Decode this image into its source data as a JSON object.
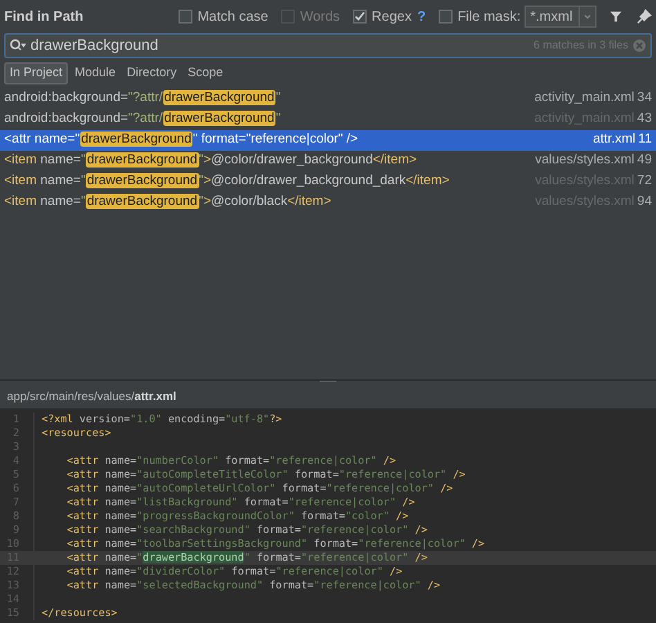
{
  "window": {
    "title": "Find in Path"
  },
  "options": [
    {
      "kind": "checkbox",
      "label": "Match case",
      "checked": false,
      "disabled": false
    },
    {
      "kind": "checkbox",
      "label": "Words",
      "checked": false,
      "disabled": true
    },
    {
      "kind": "checkbox",
      "label": "Regex",
      "checked": true,
      "disabled": false,
      "help": "?"
    },
    {
      "kind": "checkbox",
      "label": "File mask:",
      "checked": false,
      "disabled": false
    }
  ],
  "file_mask": {
    "value": "*.mxml"
  },
  "search": {
    "value": "drawerBackground",
    "summary": "6 matches in 3 files"
  },
  "scopes": [
    {
      "label": "In Project",
      "selected": true
    },
    {
      "label": "Module",
      "selected": false
    },
    {
      "label": "Directory",
      "selected": false
    },
    {
      "label": "Scope",
      "selected": false
    }
  ],
  "results": [
    {
      "selected": false,
      "segments": [
        {
          "kind": "text",
          "text": "android:background="
        },
        {
          "kind": "string",
          "text": "\"?attr/"
        },
        {
          "kind": "match",
          "text": "drawerBackground"
        },
        {
          "kind": "string",
          "text": "\""
        }
      ],
      "file": "activity_main.xml",
      "file_dim": false,
      "line": "34"
    },
    {
      "selected": false,
      "segments": [
        {
          "kind": "text",
          "text": "android:background="
        },
        {
          "kind": "string",
          "text": "\"?attr/"
        },
        {
          "kind": "match",
          "text": "drawerBackground"
        },
        {
          "kind": "string",
          "text": "\""
        }
      ],
      "file": "activity_main.xml",
      "file_dim": true,
      "line": "43"
    },
    {
      "selected": true,
      "segments": [
        {
          "kind": "text",
          "text": "<attr name="
        },
        {
          "kind": "string",
          "text": "\""
        },
        {
          "kind": "match",
          "text": "drawerBackground"
        },
        {
          "kind": "string",
          "text": "\""
        },
        {
          "kind": "text",
          "text": " format=\"reference|color\" />"
        }
      ],
      "file": "attr.xml",
      "line": "11"
    },
    {
      "selected": false,
      "segments": [
        {
          "kind": "tag",
          "text": "<item"
        },
        {
          "kind": "text",
          "text": " name="
        },
        {
          "kind": "string",
          "text": "\""
        },
        {
          "kind": "match",
          "text": "drawerBackground"
        },
        {
          "kind": "string",
          "text": "\""
        },
        {
          "kind": "tag",
          "text": ">"
        },
        {
          "kind": "text",
          "text": "@color/drawer_background"
        },
        {
          "kind": "tag",
          "text": "</item>"
        }
      ],
      "file": "values/styles.xml",
      "file_dim": false,
      "line": "49"
    },
    {
      "selected": false,
      "segments": [
        {
          "kind": "tag",
          "text": "<item"
        },
        {
          "kind": "text",
          "text": " name="
        },
        {
          "kind": "string",
          "text": "\""
        },
        {
          "kind": "match",
          "text": "drawerBackground"
        },
        {
          "kind": "string",
          "text": "\""
        },
        {
          "kind": "tag",
          "text": ">"
        },
        {
          "kind": "text",
          "text": "@color/drawer_background_dark"
        },
        {
          "kind": "tag",
          "text": "</item>"
        }
      ],
      "file": "values/styles.xml",
      "file_dim": true,
      "line": "72"
    },
    {
      "selected": false,
      "segments": [
        {
          "kind": "tag",
          "text": "<item"
        },
        {
          "kind": "text",
          "text": " name="
        },
        {
          "kind": "string",
          "text": "\""
        },
        {
          "kind": "match",
          "text": "drawerBackground"
        },
        {
          "kind": "string",
          "text": "\""
        },
        {
          "kind": "tag",
          "text": ">"
        },
        {
          "kind": "text",
          "text": "@color/black"
        },
        {
          "kind": "tag",
          "text": "</item>"
        }
      ],
      "file": "values/styles.xml",
      "file_dim": true,
      "line": "94"
    }
  ],
  "preview": {
    "path": "app/src/main/res/values/",
    "file": "attr.xml",
    "lines": [
      {
        "number": "1",
        "current": false,
        "tokens": [
          {
            "kind": "tag",
            "text": "<?xml"
          },
          {
            "kind": "attr",
            "text": " version="
          },
          {
            "kind": "string",
            "text": "\"1.0\""
          },
          {
            "kind": "attr",
            "text": " encoding="
          },
          {
            "kind": "string",
            "text": "\"utf-8\""
          },
          {
            "kind": "tag",
            "text": "?>"
          }
        ]
      },
      {
        "number": "2",
        "current": false,
        "tokens": [
          {
            "kind": "tag",
            "text": "<resources>"
          }
        ]
      },
      {
        "number": "3",
        "current": false
      },
      {
        "number": "4",
        "current": false,
        "tokens": [
          {
            "kind": "tag",
            "text": "    <attr"
          },
          {
            "kind": "attr",
            "text": " name="
          },
          {
            "kind": "string",
            "text": "\"numberColor\""
          },
          {
            "kind": "attr",
            "text": " format="
          },
          {
            "kind": "string",
            "text": "\"reference|color\""
          },
          {
            "kind": "tag",
            "text": " />"
          }
        ]
      },
      {
        "number": "5",
        "current": false,
        "tokens": [
          {
            "kind": "tag",
            "text": "    <attr"
          },
          {
            "kind": "attr",
            "text": " name="
          },
          {
            "kind": "string",
            "text": "\"autoCompleteTitleColor\""
          },
          {
            "kind": "attr",
            "text": " format="
          },
          {
            "kind": "string",
            "text": "\"reference|color\""
          },
          {
            "kind": "tag",
            "text": " />"
          }
        ]
      },
      {
        "number": "6",
        "current": false,
        "tokens": [
          {
            "kind": "tag",
            "text": "    <attr"
          },
          {
            "kind": "attr",
            "text": " name="
          },
          {
            "kind": "string",
            "text": "\"autoCompleteUrlColor\""
          },
          {
            "kind": "attr",
            "text": " format="
          },
          {
            "kind": "string",
            "text": "\"reference|color\""
          },
          {
            "kind": "tag",
            "text": " />"
          }
        ]
      },
      {
        "number": "7",
        "current": false,
        "tokens": [
          {
            "kind": "tag",
            "text": "    <attr"
          },
          {
            "kind": "attr",
            "text": " name="
          },
          {
            "kind": "string",
            "text": "\"listBackground\""
          },
          {
            "kind": "attr",
            "text": " format="
          },
          {
            "kind": "string",
            "text": "\"reference|color\""
          },
          {
            "kind": "tag",
            "text": " />"
          }
        ]
      },
      {
        "number": "8",
        "current": false,
        "tokens": [
          {
            "kind": "tag",
            "text": "    <attr"
          },
          {
            "kind": "attr",
            "text": " name="
          },
          {
            "kind": "string",
            "text": "\"progressBackgroundColor\""
          },
          {
            "kind": "attr",
            "text": " format="
          },
          {
            "kind": "string",
            "text": "\"color\""
          },
          {
            "kind": "tag",
            "text": " />"
          }
        ]
      },
      {
        "number": "9",
        "current": false,
        "tokens": [
          {
            "kind": "tag",
            "text": "    <attr"
          },
          {
            "kind": "attr",
            "text": " name="
          },
          {
            "kind": "string",
            "text": "\"searchBackground\""
          },
          {
            "kind": "attr",
            "text": " format="
          },
          {
            "kind": "string",
            "text": "\"reference|color\""
          },
          {
            "kind": "tag",
            "text": " />"
          }
        ]
      },
      {
        "number": "10",
        "current": false,
        "tokens": [
          {
            "kind": "tag",
            "text": "    <attr"
          },
          {
            "kind": "attr",
            "text": " name="
          },
          {
            "kind": "string",
            "text": "\"toolbarSettingsBackground\""
          },
          {
            "kind": "attr",
            "text": " format="
          },
          {
            "kind": "string",
            "text": "\"reference|color\""
          },
          {
            "kind": "tag",
            "text": " />"
          }
        ]
      },
      {
        "number": "11",
        "current": true,
        "tokens": [
          {
            "kind": "tag",
            "text": "    <attr"
          },
          {
            "kind": "attr",
            "text": " name="
          },
          {
            "kind": "string",
            "text": "\""
          },
          {
            "kind": "match",
            "text": "drawerBackground"
          },
          {
            "kind": "string",
            "text": "\""
          },
          {
            "kind": "attr",
            "text": " format="
          },
          {
            "kind": "string",
            "text": "\"reference|color\""
          },
          {
            "kind": "tag",
            "text": " />"
          }
        ]
      },
      {
        "number": "12",
        "current": false,
        "tokens": [
          {
            "kind": "tag",
            "text": "    <attr"
          },
          {
            "kind": "attr",
            "text": " name="
          },
          {
            "kind": "string",
            "text": "\"dividerColor\""
          },
          {
            "kind": "attr",
            "text": " format="
          },
          {
            "kind": "string",
            "text": "\"reference|color\""
          },
          {
            "kind": "tag",
            "text": " />"
          }
        ]
      },
      {
        "number": "13",
        "current": false,
        "tokens": [
          {
            "kind": "tag",
            "text": "    <attr"
          },
          {
            "kind": "attr",
            "text": " name="
          },
          {
            "kind": "string",
            "text": "\"selectedBackground\""
          },
          {
            "kind": "attr",
            "text": " format="
          },
          {
            "kind": "string",
            "text": "\"reference|color\""
          },
          {
            "kind": "tag",
            "text": " />"
          }
        ]
      },
      {
        "number": "14",
        "current": false
      },
      {
        "number": "15",
        "current": false,
        "tokens": [
          {
            "kind": "tag",
            "text": "</resources>"
          }
        ]
      }
    ]
  }
}
